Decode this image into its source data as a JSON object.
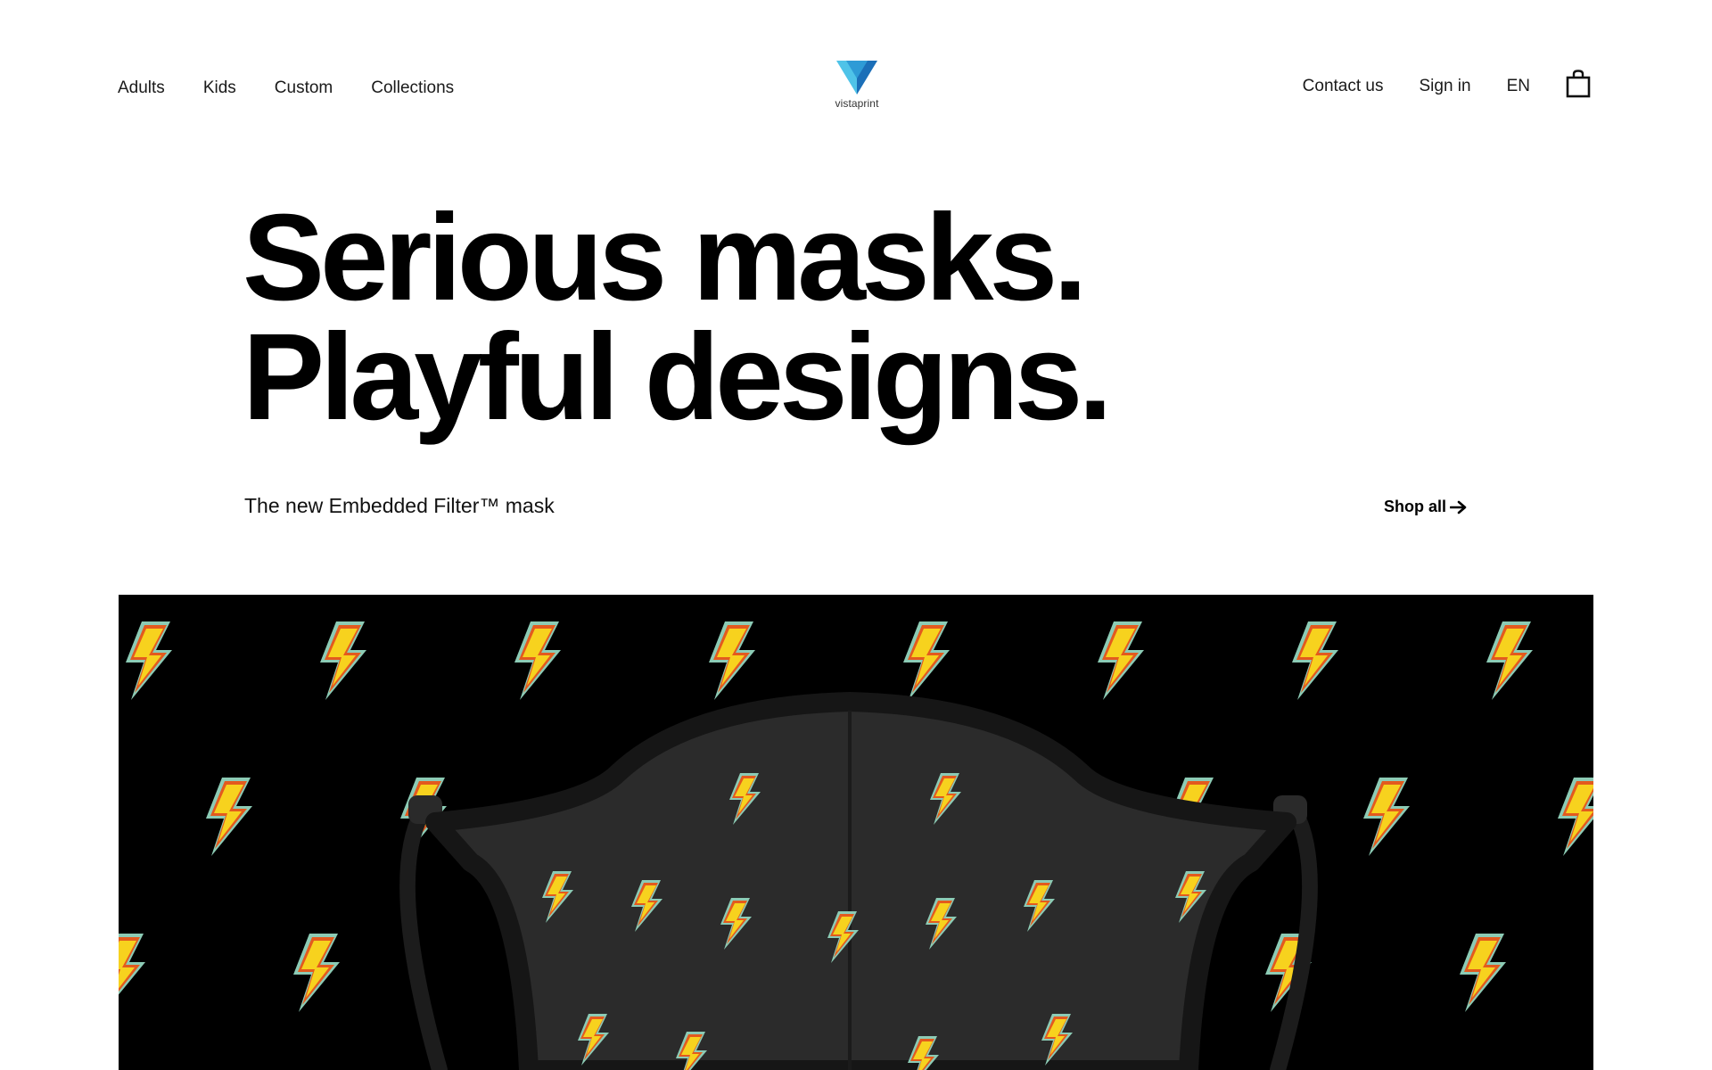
{
  "header": {
    "nav_left": [
      {
        "label": "Adults"
      },
      {
        "label": "Kids"
      },
      {
        "label": "Custom"
      },
      {
        "label": "Collections"
      }
    ],
    "logo_text": "vistaprint",
    "nav_right": [
      {
        "label": "Contact us"
      },
      {
        "label": "Sign in"
      },
      {
        "label": "EN"
      }
    ],
    "cart_icon": "shopping-bag-icon"
  },
  "hero": {
    "title_line1": "Serious masks.",
    "title_line2": "Playful designs.",
    "subtitle": "The new Embedded Filter™ mask",
    "cta_label": "Shop all",
    "cta_icon": "arrow-right-icon"
  },
  "banner": {
    "image": "lightning-bolt-pattern-mask-photo",
    "background_color": "#000000",
    "bolt_fill": "#F7D21E",
    "bolt_outline": "#E35A1E",
    "bolt_edge": "#8CCBB5"
  },
  "colors": {
    "logo_light": "#4FC3E8",
    "logo_dark": "#1B6FB8",
    "text": "#111111"
  }
}
